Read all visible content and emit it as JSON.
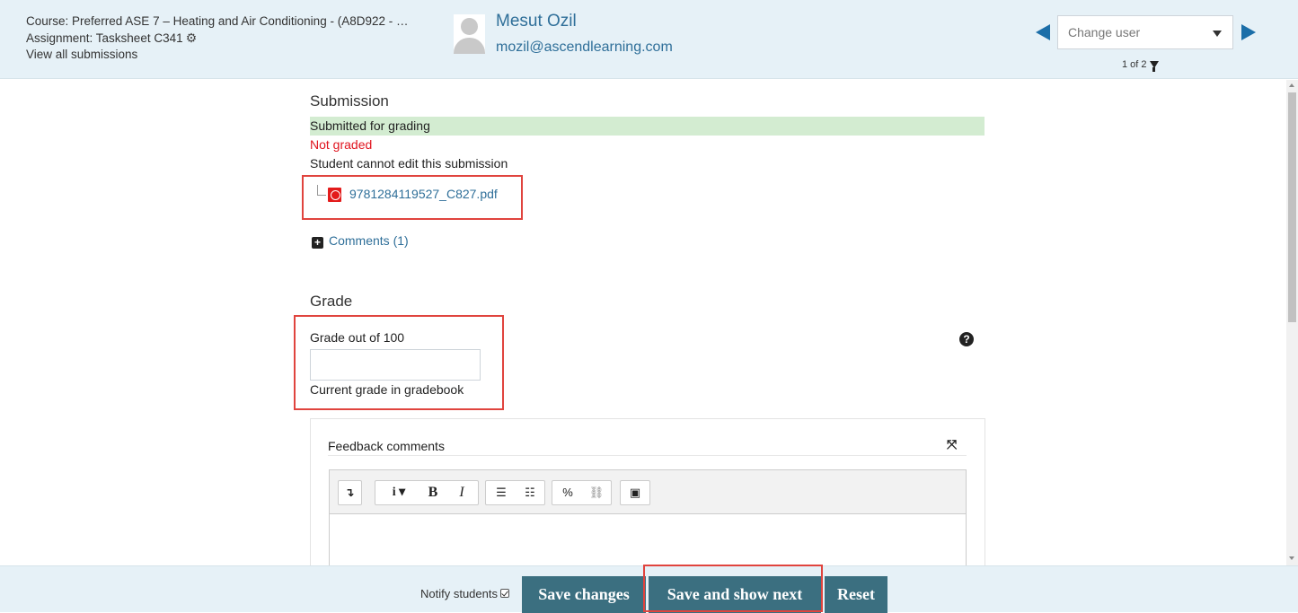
{
  "header": {
    "course": "Course: Preferred ASE 7 – Heating and Air Conditioning - (A8D922 - …",
    "assignment": "Assignment: Tasksheet C341",
    "view_all": "View all submissions",
    "user_name": "Mesut Ozil",
    "user_email": "mozil@ascendlearning.com",
    "change_user_placeholder": "Change user",
    "count": "1 of 2"
  },
  "submission": {
    "heading": "Submission",
    "status": "Submitted for grading",
    "grading_status": "Not graded",
    "edit_status": "Student cannot edit this submission",
    "file_name": "9781284119527_C827.pdf",
    "comments_link": "Comments (1)"
  },
  "grade": {
    "heading": "Grade",
    "label": "Grade out of 100",
    "value": "",
    "current_label": "Current grade in gradebook"
  },
  "feedback": {
    "title": "Feedback comments",
    "toolbar": {
      "show_more": "↴",
      "info": "i ▾",
      "bold": "B",
      "italic": "I",
      "bullets": "☰",
      "numbered": "☷",
      "link": "%",
      "unlink": "⛓",
      "image": "▣"
    }
  },
  "footer": {
    "notify_label": "Notify students",
    "notify_checked": true,
    "save_changes": "Save changes",
    "save_next": "Save and show next",
    "reset": "Reset"
  },
  "colors": {
    "header_bg": "#e6f1f7",
    "link": "#2f6f99",
    "success_bg": "#d3ecd1",
    "error_text": "#e0141e",
    "button_bg": "#3b6f80",
    "highlight": "#e0443e"
  }
}
